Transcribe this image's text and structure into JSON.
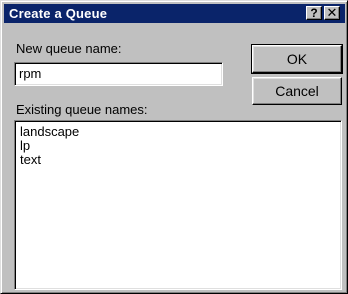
{
  "window": {
    "title": "Create a Queue",
    "help_glyph": "?",
    "close_glyph": "✕"
  },
  "form": {
    "name_label": "New queue name:",
    "name_value": "rpm",
    "existing_label": "Existing queue names:",
    "existing_items": [
      "landscape",
      "lp",
      "text"
    ]
  },
  "buttons": {
    "ok_label": "OK",
    "cancel_label": "Cancel"
  },
  "colors": {
    "titlebar": "#0a246a",
    "face": "#c0c0c0"
  }
}
